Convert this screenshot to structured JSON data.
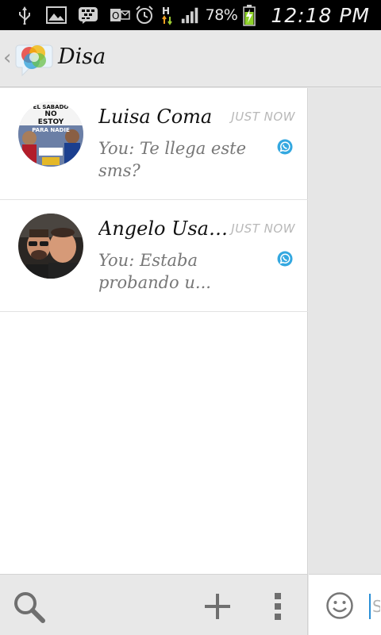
{
  "status_bar": {
    "battery_percent": "78%",
    "time": "12:18 PM",
    "icons": [
      "usb-icon",
      "gallery-icon",
      "bbm-icon",
      "outlook-icon",
      "alarm-icon",
      "data-h-icon",
      "signal-icon",
      "battery-charging-icon"
    ]
  },
  "action_bar": {
    "title": "Disa",
    "back_icon": "chevron-left-icon"
  },
  "conversations": [
    {
      "name": "Luisa Coma",
      "time": "JUST NOW",
      "preview": "You: Te llega este sms?",
      "service_icon": "whatsapp-icon",
      "avatar": "group-photo-avatar",
      "avatar_caption": [
        "EL SABADO",
        "NO",
        "ESTOY",
        "PARA NADIE"
      ]
    },
    {
      "name": "Angelo Usa ...",
      "time": "JUST NOW",
      "preview": "You: Estaba probando u...",
      "service_icon": "whatsapp-icon",
      "avatar": "selfie-photo-avatar"
    }
  ],
  "bottom_bar": {
    "search_icon": "search-icon",
    "add_icon": "plus-icon",
    "menu_icon": "overflow-menu-icon"
  },
  "composer": {
    "emoji_icon": "smiley-icon",
    "text": "S"
  },
  "colors": {
    "accent_blue": "#2a9fd8",
    "whatsapp_badge": "#34a8e0",
    "toolbar_bg": "#e8e8e8",
    "list_bg": "#ffffff"
  }
}
